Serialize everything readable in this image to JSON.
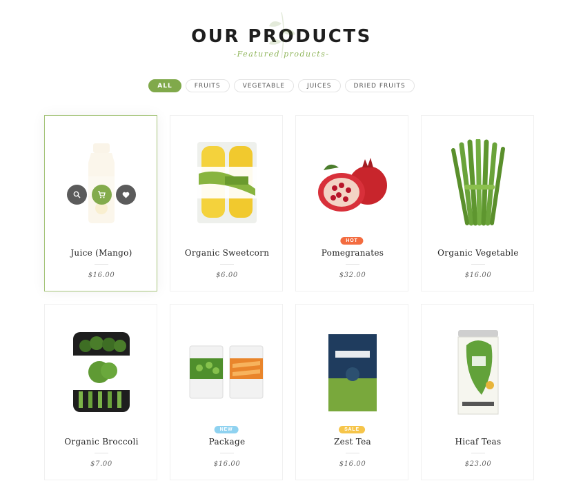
{
  "header": {
    "title": "OUR PRODUCTS",
    "subtitle": "-Featured products-"
  },
  "filters": [
    {
      "label": "ALL",
      "active": true
    },
    {
      "label": "FRUITS",
      "active": false
    },
    {
      "label": "VEGETABLE",
      "active": false
    },
    {
      "label": "JUICES",
      "active": false
    },
    {
      "label": "DRIED FRUITS",
      "active": false
    }
  ],
  "colors": {
    "accent": "#80a94b",
    "hot": "#f36c40",
    "new": "#8fd2f0",
    "sale": "#f6c54a"
  },
  "products": [
    {
      "name": "Juice (Mango)",
      "price": "$16.00",
      "icon": "juice-bottle-icon"
    },
    {
      "name": "Organic Sweetcorn",
      "price": "$6.00",
      "icon": "sweetcorn-pack-icon"
    },
    {
      "name": "Pomegranates",
      "price": "$32.00",
      "badge": "HOT",
      "icon": "pomegranate-icon"
    },
    {
      "name": "Organic Vegetable",
      "price": "$16.00",
      "icon": "asparagus-icon"
    },
    {
      "name": "Organic Broccoli",
      "price": "$7.00",
      "icon": "broccoli-pack-icon"
    },
    {
      "name": "Package",
      "price": "$16.00",
      "badge": "NEW",
      "icon": "cans-icon"
    },
    {
      "name": "Zest Tea",
      "price": "$16.00",
      "badge": "SALE",
      "icon": "tea-pouch-icon"
    },
    {
      "name": "Hicaf Teas",
      "price": "$23.00",
      "icon": "tea-tin-icon"
    }
  ],
  "hover_actions": [
    {
      "icon": "search-icon",
      "glyph": "⌕"
    },
    {
      "icon": "cart-icon",
      "glyph": "🛒"
    },
    {
      "icon": "heart-icon",
      "glyph": "♥"
    }
  ]
}
